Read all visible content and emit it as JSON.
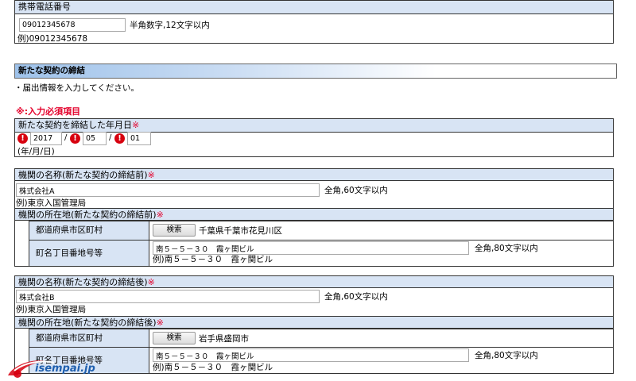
{
  "phone": {
    "label": "携帯電話番号",
    "value": "09012345678",
    "hint": "半角数字,12文字以内",
    "example": "例)09012345678"
  },
  "section": {
    "title": "新たな契約の締結",
    "instruction": "・届出情報を入力してください。",
    "required_note": "※:入力必須項目"
  },
  "date": {
    "label": "新たな契約を締結した年月日",
    "required_mark": "※",
    "year": "2017",
    "month": "05",
    "day": "01",
    "separator": "/",
    "format": "(年/月/日)",
    "error_icon": "!"
  },
  "org_before": {
    "name_label": "機関の名称(新たな契約の締結前)",
    "name_value": "株式会社A",
    "name_hint": "全角,60文字以内",
    "name_example": "例)東京入国管理局",
    "addr_label": "機関の所在地(新たな契約の締結前)",
    "pref_label": "都道府県市区町村",
    "search_label": "検索",
    "pref_value": "千葉県千葉市花見川区",
    "street_label": "町名丁目番地号等",
    "street_value": "南５－５－３０　霞ヶ関ビル",
    "street_hint": "全角,80文字以内",
    "street_example": "例)南５－５－３０　霞ヶ関ビル",
    "required_mark": "※"
  },
  "org_after": {
    "name_label": "機関の名称(新たな契約の締結後)",
    "name_value": "株式会社B",
    "name_hint": "全角,60文字以内",
    "name_example": "例)東京入国管理局",
    "addr_label": "機関の所在地(新たな契約の締結後)",
    "pref_label": "都道府県市区町村",
    "search_label": "検索",
    "pref_value": "岩手県盛岡市",
    "street_label": "町名丁目番地号等",
    "street_value": "南５－５－３０　霞ヶ関ビル",
    "street_hint": "全角,80文字以内",
    "street_example": "例)南５－５－３０　霞ヶ関ビル",
    "required_mark": "※"
  },
  "watermark": {
    "text": "isempai.jp"
  },
  "colors": {
    "header_bg": "#d8e4f4",
    "required_red": "#e4002b",
    "error_red": "#d7000f",
    "section_blue": "#9ec2ea"
  }
}
